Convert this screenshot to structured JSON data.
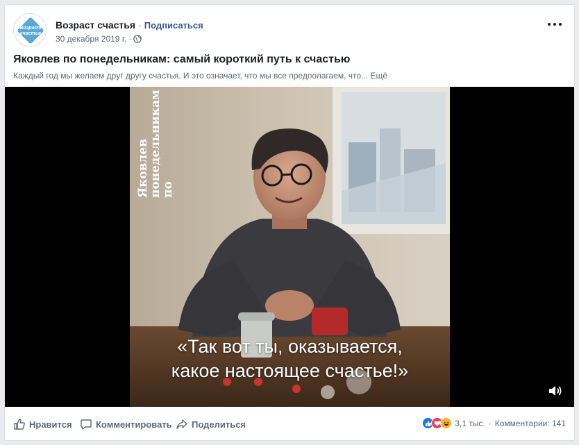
{
  "post": {
    "page_name": "Возраст счастья",
    "separator": "·",
    "subscribe_label": "Подписаться",
    "date": "30 декабря 2019 г.",
    "meta_separator": "·",
    "title": "Яковлев по понедельникам: самый короткий путь к счастью",
    "description": "Каждый год мы желаем друг другу счастья. И это означает, что мы все предполагаем, что...",
    "more_label": "Ещё",
    "avatar_text_line1": "Возраст",
    "avatar_text_line2": "счастья"
  },
  "video": {
    "overlay_line1": "по",
    "overlay_line2": "Яковлев",
    "overlay_line3": "понедельникам",
    "caption_line1": "«Так вот ты, оказывается,",
    "caption_line2": "какое настоящее счастье!»"
  },
  "footer": {
    "like_label": "Нравится",
    "comment_label": "Комментировать",
    "share_label": "Поделиться",
    "reactions_count": "3,1 тыс.",
    "reactions_separator": "·",
    "comments_count": "Комментарии: 141"
  },
  "colors": {
    "link": "#385898",
    "like_blue": "#1877f2",
    "love_red": "#f33e58",
    "haha_yellow": "#f7b125"
  }
}
